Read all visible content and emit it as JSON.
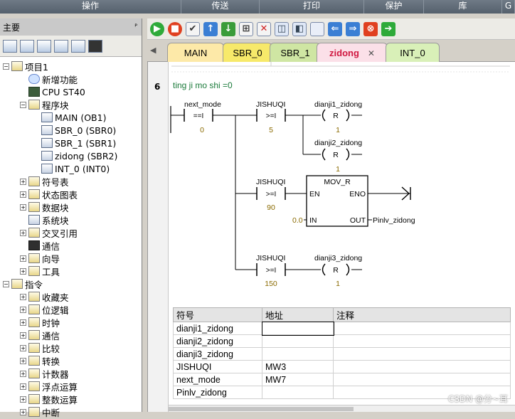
{
  "ribbon": {
    "groups": [
      "操作",
      "传送",
      "打印",
      "保护",
      "库",
      "G"
    ]
  },
  "sidebar": {
    "title": "主要",
    "pin": "ᴾ",
    "tree": [
      {
        "label": "项目1",
        "icon": "project-icon",
        "expander": "−"
      },
      {
        "label": "新增功能",
        "icon": "help-icon",
        "expander": ""
      },
      {
        "label": "CPU ST40",
        "icon": "cpu-icon",
        "expander": ""
      },
      {
        "label": "程序块",
        "icon": "folder-icon",
        "expander": "−"
      },
      {
        "label": "MAIN (OB1)",
        "icon": "block-icon",
        "expander": ""
      },
      {
        "label": "SBR_0 (SBR0)",
        "icon": "block-icon",
        "expander": ""
      },
      {
        "label": "SBR_1 (SBR1)",
        "icon": "block-icon",
        "expander": ""
      },
      {
        "label": "zidong (SBR2)",
        "icon": "block-icon",
        "expander": ""
      },
      {
        "label": "INT_0 (INT0)",
        "icon": "block-icon",
        "expander": ""
      },
      {
        "label": "符号表",
        "icon": "folder-icon",
        "expander": "+"
      },
      {
        "label": "状态图表",
        "icon": "folder-icon",
        "expander": "+"
      },
      {
        "label": "数据块",
        "icon": "folder-icon",
        "expander": "+"
      },
      {
        "label": "系统块",
        "icon": "block-icon",
        "expander": ""
      },
      {
        "label": "交叉引用",
        "icon": "folder-icon",
        "expander": "+"
      },
      {
        "label": "通信",
        "icon": "pc-icon",
        "expander": ""
      },
      {
        "label": "向导",
        "icon": "wizard-icon",
        "expander": "+"
      },
      {
        "label": "工具",
        "icon": "folder-icon",
        "expander": "+"
      },
      {
        "label": "指令",
        "icon": "instructions-icon",
        "expander": "−"
      },
      {
        "label": "收藏夹",
        "icon": "folder-icon",
        "expander": "+"
      },
      {
        "label": "位逻辑",
        "icon": "bit-logic-icon",
        "expander": "+"
      },
      {
        "label": "时钟",
        "icon": "clock-icon",
        "expander": "+"
      },
      {
        "label": "通信",
        "icon": "comm-icon",
        "expander": "+"
      },
      {
        "label": "比较",
        "icon": "compare-icon",
        "expander": "+"
      },
      {
        "label": "转换",
        "icon": "convert-icon",
        "expander": "+"
      },
      {
        "label": "计数器",
        "icon": "counter-icon",
        "expander": "+"
      },
      {
        "label": "浮点运算",
        "icon": "float-icon",
        "expander": "+"
      },
      {
        "label": "整数运算",
        "icon": "integer-icon",
        "expander": "+"
      },
      {
        "label": "中断",
        "icon": "interrupt-icon",
        "expander": "+"
      }
    ]
  },
  "tabs": [
    {
      "label": "MAIN",
      "color": "#fde9a8"
    },
    {
      "label": "SBR_0",
      "color": "#f7e96a"
    },
    {
      "label": "SBR_1",
      "color": "#cfe6a3"
    },
    {
      "label": "zidong",
      "color": "#fbe0e8"
    },
    {
      "label": "INT_0",
      "color": "#d9f0b8"
    }
  ],
  "tab_close": "✕",
  "network": {
    "number": "6",
    "comment": "ting ji mo shi =0",
    "contacts": [
      {
        "symbol": "next_mode",
        "op": "==I",
        "value": "0"
      },
      {
        "symbol": "JISHUQI",
        "op": ">=I",
        "value": "5"
      },
      {
        "symbol": "JISHUQI",
        "op": ">=I",
        "value": "90"
      },
      {
        "symbol": "JISHUQI",
        "op": ">=I",
        "value": "150"
      }
    ],
    "coils": [
      {
        "symbol": "dianji1_zidong",
        "type": "R",
        "value": "1"
      },
      {
        "symbol": "dianji2_zidong",
        "type": "R",
        "value": "1"
      },
      {
        "symbol": "dianji3_zidong",
        "type": "R",
        "value": "1"
      }
    ],
    "box": {
      "title": "MOV_R",
      "en": "EN",
      "eno": "ENO",
      "in_label": "IN",
      "out_label": "OUT",
      "in_value": "0.0",
      "out_value": "Pinlv_zidong"
    }
  },
  "symbol_table": {
    "headers": [
      "符号",
      "地址",
      "注释"
    ],
    "rows": [
      [
        "dianji1_zidong",
        "",
        ""
      ],
      [
        "dianji2_zidong",
        "",
        ""
      ],
      [
        "dianji3_zidong",
        "",
        ""
      ],
      [
        "JISHUQI",
        "MW3",
        ""
      ],
      [
        "next_mode",
        "MW7",
        ""
      ],
      [
        "Pinlv_zidong",
        "",
        ""
      ]
    ]
  },
  "watermark": "CSDN @分~耳"
}
